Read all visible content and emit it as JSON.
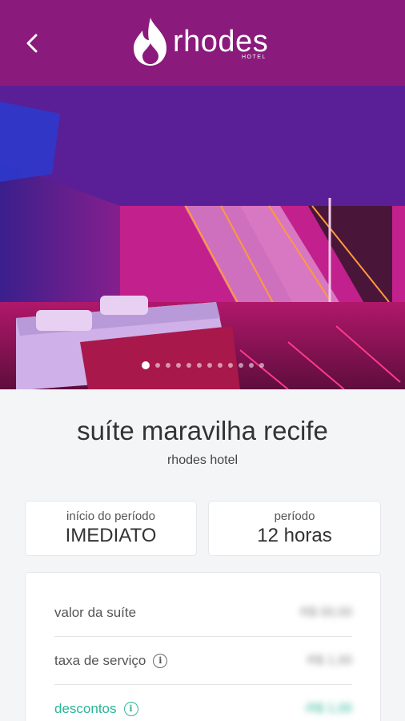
{
  "header": {
    "brand": "rhodes",
    "brand_sub": "HOTEL",
    "back_icon": "chevron-left-icon",
    "logo_icon": "flame-icon",
    "bg_color": "#8a1a7b"
  },
  "gallery": {
    "photo_count": 12,
    "active_index": 0
  },
  "suite": {
    "title": "suíte maravilha recife",
    "hotel": "rhodes hotel"
  },
  "period": {
    "start_label": "início do período",
    "start_value": "IMEDIATO",
    "duration_label": "período",
    "duration_value": "12 horas"
  },
  "pricing": {
    "rows": [
      {
        "label": "valor da suíte",
        "amount": "R$ 00,00"
      },
      {
        "label": "taxa de serviço",
        "amount": "R$ 1,00"
      },
      {
        "label": "descontos",
        "amount": "-R$ 1,00"
      }
    ],
    "discount_color": "#2bb596"
  }
}
